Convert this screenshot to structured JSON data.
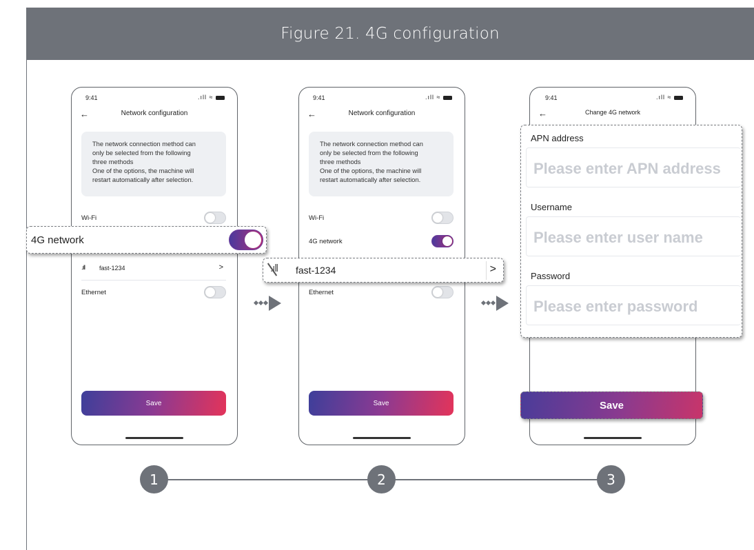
{
  "figure_title": "Figure 21.  4G configuration",
  "status": {
    "time": "9:41",
    "icons": ".ıll ≈"
  },
  "screen1": {
    "title": "Network configuration",
    "back": "←",
    "info_lines": [
      "The network connection method can",
      "only be selected from the following",
      "three methods",
      "One of the options, the machine will",
      "restart automatically after selection."
    ],
    "wifi": "Wi-Fi",
    "net4g": "4G network",
    "signal_icon": ".ıll",
    "network_name": "fast-1234",
    "chevron": ">",
    "ethernet": "Ethernet",
    "save": "Save"
  },
  "screen2": {
    "title": "Network configuration",
    "back": "←",
    "info_lines": [
      "The network connection method can",
      "only be selected from the following",
      "three methods",
      "One of the options, the machine will",
      "restart automatically after selection."
    ],
    "wifi": "Wi-Fi",
    "net4g": "4G network",
    "ethernet": "Ethernet",
    "save": "Save"
  },
  "screen3": {
    "title": "Change 4G network",
    "back": "←"
  },
  "callouts": {
    "net4g_label": "4G network",
    "fast_name": "fast-1234",
    "fast_icon": ".ıll",
    "fast_chevron": ">",
    "apn_label": "APN address",
    "apn_placeholder": "Please enter APN address",
    "username_label": "Username",
    "username_placeholder": "Please enter user name",
    "password_label": "Password",
    "password_placeholder": "Please enter password",
    "save": "Save"
  },
  "steps": [
    "1",
    "2",
    "3"
  ],
  "colors": {
    "header": "#6e7279",
    "accent_start": "#3e3f9a",
    "accent_end": "#e3345a"
  }
}
